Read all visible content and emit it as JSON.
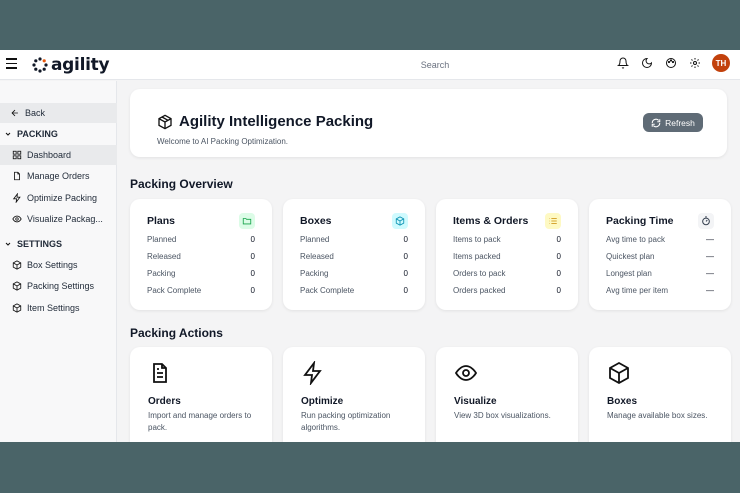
{
  "topbar": {
    "brand": "agility",
    "search_label": "Search",
    "avatar_initials": "TH"
  },
  "sidebar": {
    "back_label": "Back",
    "sections": [
      {
        "title": "PACKING",
        "items": [
          "Dashboard",
          "Manage Orders",
          "Optimize Packing",
          "Visualize Packag..."
        ]
      },
      {
        "title": "SETTINGS",
        "items": [
          "Box Settings",
          "Packing Settings",
          "Item Settings"
        ]
      }
    ]
  },
  "header": {
    "title": "Agility Intelligence Packing",
    "subtitle": "Welcome to AI Packing Optimization.",
    "refresh_label": "Refresh"
  },
  "overview": {
    "title": "Packing Overview",
    "cards": [
      {
        "title": "Plans",
        "icon": "folder-icon",
        "color": "#16a34a",
        "bg": "#dcfce7",
        "rows": [
          [
            "Planned",
            "0"
          ],
          [
            "Released",
            "0"
          ],
          [
            "Packing",
            "0"
          ],
          [
            "Pack Complete",
            "0"
          ]
        ]
      },
      {
        "title": "Boxes",
        "icon": "cube-icon",
        "color": "#0891b2",
        "bg": "#cffafe",
        "rows": [
          [
            "Planned",
            "0"
          ],
          [
            "Released",
            "0"
          ],
          [
            "Packing",
            "0"
          ],
          [
            "Pack Complete",
            "0"
          ]
        ]
      },
      {
        "title": "Items & Orders",
        "icon": "list-icon",
        "color": "#ca8a04",
        "bg": "#fef9c3",
        "rows": [
          [
            "Items to pack",
            "0"
          ],
          [
            "Items packed",
            "0"
          ],
          [
            "Orders to pack",
            "0"
          ],
          [
            "Orders packed",
            "0"
          ]
        ]
      },
      {
        "title": "Packing Time",
        "icon": "timer-icon",
        "color": "#374151",
        "bg": "#f3f4f6",
        "rows": [
          [
            "Avg time to pack",
            "—"
          ],
          [
            "Quickest plan",
            "—"
          ],
          [
            "Longest plan",
            "—"
          ],
          [
            "Avg time per item",
            "—"
          ]
        ]
      }
    ]
  },
  "actions": {
    "title": "Packing Actions",
    "cards": [
      {
        "title": "Orders",
        "icon": "document-icon",
        "desc": "Import and manage orders to pack."
      },
      {
        "title": "Optimize",
        "icon": "lightning-icon",
        "desc": "Run packing optimization algorithms."
      },
      {
        "title": "Visualize",
        "icon": "eye-icon",
        "desc": "View 3D box visualizations."
      },
      {
        "title": "Boxes",
        "icon": "box-icon",
        "desc": "Manage available box sizes."
      }
    ]
  }
}
